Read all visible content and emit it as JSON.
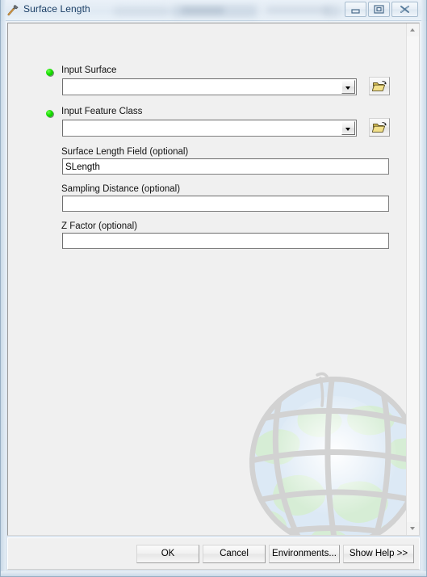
{
  "window": {
    "title": "Surface Length",
    "icon": "hammer-tool-icon",
    "controls": {
      "minimize": "Minimize",
      "restore": "Restore",
      "close": "Close"
    }
  },
  "form": {
    "fields": [
      {
        "id": "input-surface",
        "label": "Input Surface",
        "required": true,
        "type": "combo",
        "value": "",
        "browse": true
      },
      {
        "id": "input-feature-class",
        "label": "Input Feature Class",
        "required": true,
        "type": "combo",
        "value": "",
        "browse": true
      },
      {
        "id": "surface-length-field",
        "label": "Surface Length Field (optional)",
        "required": false,
        "type": "text",
        "value": "SLength",
        "browse": false
      },
      {
        "id": "sampling-distance",
        "label": "Sampling Distance (optional)",
        "required": false,
        "type": "text",
        "value": "",
        "browse": false
      },
      {
        "id": "z-factor",
        "label": "Z Factor (optional)",
        "required": false,
        "type": "text",
        "value": "",
        "browse": false
      }
    ]
  },
  "watermark": {
    "name": "globe-watermark",
    "ocean_color": "#dce9f5",
    "land_color": "#d8ecd6",
    "graticule_color": "#d2d2d2"
  },
  "scrollbar": {
    "up_arrow": "scroll-up-arrow",
    "down_arrow": "scroll-down-arrow"
  },
  "buttons": {
    "ok": "OK",
    "cancel": "Cancel",
    "environments": "Environments...",
    "show_help": "Show Help >>"
  },
  "colors": {
    "required_indicator": "#17dc00",
    "panel_background": "#f0f0f0",
    "title_text": "#1b3f66"
  }
}
